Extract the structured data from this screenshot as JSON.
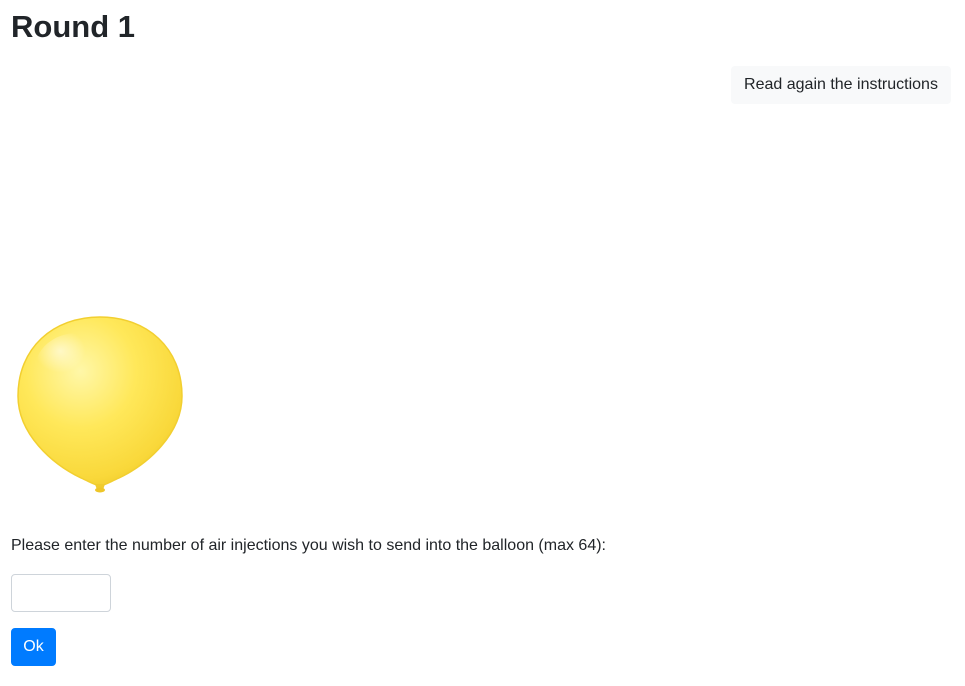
{
  "header": {
    "title": "Round 1"
  },
  "toolbar": {
    "instructions_label": "Read again the instructions"
  },
  "balloon": {
    "icon": "balloon-icon",
    "color": "#ffe34d"
  },
  "form": {
    "prompt": "Please enter the number of air injections you wish to send into the balloon (max 64):",
    "input_value": "",
    "submit_label": "Ok"
  },
  "colors": {
    "primary": "#007bff",
    "light_button": "#f8f9fa",
    "text": "#212529"
  }
}
